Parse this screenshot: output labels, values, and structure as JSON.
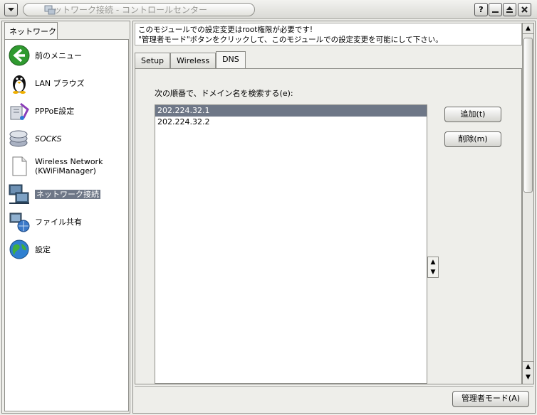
{
  "window": {
    "title": "ネットワーク接続 - コントロールセンター",
    "menu_icon": "chevron-down-icon",
    "buttons": [
      "help-icon",
      "minimize-icon",
      "maximize-icon",
      "close-icon"
    ]
  },
  "sidebar": {
    "tab_label": "ネットワーク",
    "items": [
      {
        "label": "前のメニュー",
        "icon": "back-arrow-icon"
      },
      {
        "label": "LAN ブラウズ",
        "icon": "tux-icon"
      },
      {
        "label": "PPPoE設定",
        "icon": "pppoe-icon"
      },
      {
        "label": "SOCKS",
        "icon": "socks-icon"
      },
      {
        "label": "Wireless Network",
        "label2": "(KWiFiManager)",
        "icon": "document-icon"
      },
      {
        "label": "ネットワーク接続",
        "icon": "network-connection-icon"
      },
      {
        "label": "ファイル共有",
        "icon": "file-share-icon"
      },
      {
        "label": "設定",
        "icon": "globe-icon"
      }
    ],
    "selected_index": 5
  },
  "info": {
    "line1": "このモジュールでの設定変更はroot権限が必要です!",
    "line2": "\"管理者モード\"ボタンをクリックして、このモジュールでの設定変更を可能にして下さい。"
  },
  "tabs": [
    {
      "label": "Setup"
    },
    {
      "label": "Wireless"
    },
    {
      "label": "DNS"
    }
  ],
  "active_tab": 2,
  "dns": {
    "search_label": "次の順番で、ドメイン名を検索する(e):",
    "entries": [
      "202.224.32.1",
      "202.224.32.2"
    ],
    "selected_index": 0,
    "add_label": "追加(t)",
    "remove_label": "削除(m)"
  },
  "footer": {
    "admin_label": "管理者モード(A)"
  },
  "colors": {
    "selection": "#6e7787",
    "window_bg": "#eeeeea"
  }
}
